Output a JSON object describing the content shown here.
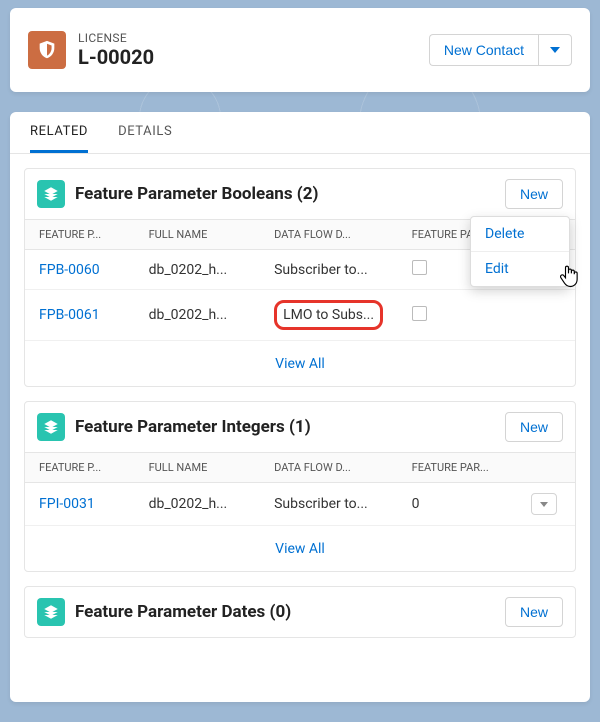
{
  "header": {
    "type_label": "LICENSE",
    "title": "L-00020",
    "new_contact_label": "New Contact"
  },
  "tabs": {
    "related": "RELATED",
    "details": "DETAILS"
  },
  "new_button_label": "New",
  "view_all_label": "View All",
  "columns": {
    "feature_p": "FEATURE P...",
    "full_name": "FULL NAME",
    "data_flow": "DATA FLOW D...",
    "feature_par": "FEATURE PAR..."
  },
  "popover": {
    "delete": "Delete",
    "edit": "Edit"
  },
  "sections": [
    {
      "title": "Feature Parameter Booleans (2)",
      "type": "boolean",
      "rows": [
        {
          "id": "FPB-0060",
          "full_name": "db_0202_h...",
          "data_flow": "Subscriber to...",
          "value": ""
        },
        {
          "id": "FPB-0061",
          "full_name": "db_0202_h...",
          "data_flow": "LMO to Subs...",
          "value": ""
        }
      ]
    },
    {
      "title": "Feature Parameter Integers (1)",
      "type": "text",
      "rows": [
        {
          "id": "FPI-0031",
          "full_name": "db_0202_h...",
          "data_flow": "Subscriber to...",
          "value": "0"
        }
      ]
    },
    {
      "title": "Feature Parameter Dates (0)",
      "type": "none",
      "rows": []
    }
  ]
}
